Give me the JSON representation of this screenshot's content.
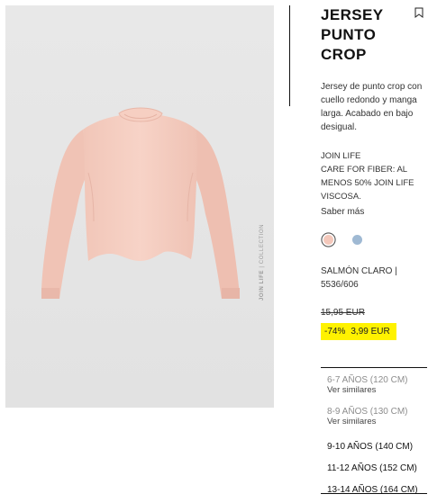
{
  "product": {
    "title_lines": [
      "JERSEY",
      "PUNTO",
      "CROP"
    ],
    "description": "Jersey de punto crop con cuello redondo y manga larga. Acabado en bajo desigual.",
    "join_life_lines": [
      "JOIN LIFE",
      "CARE FOR FIBER: AL",
      "MENOS 50% JOIN LIFE",
      "VISCOSA."
    ],
    "more_link": "Saber más",
    "color_lines": [
      "SALMÓN CLARO |",
      "5536/606"
    ],
    "old_price": "15,95 EUR",
    "discount": "-74%",
    "price": "3,99 EUR",
    "watermark_bold": "JOIN LIFE",
    "watermark_rest": " | COLLECTION"
  },
  "swatches": [
    {
      "name": "salmon",
      "color": "#f4c8bb",
      "selected": true
    },
    {
      "name": "light-blue",
      "color": "#9fb9d3",
      "selected": false
    }
  ],
  "sizes": [
    {
      "label": "6-7 AÑOS (120 CM)",
      "similar": "Ver similares",
      "available": false
    },
    {
      "label": "8-9 AÑOS (130 CM)",
      "similar": "Ver similares",
      "available": false
    },
    {
      "label": "9-10 AÑOS (140 CM)",
      "available": true
    },
    {
      "label": "11-12 AÑOS (152 CM)",
      "available": true
    },
    {
      "label": "13-14 AÑOS (164 CM)",
      "available": true
    }
  ],
  "icons": {
    "bookmark": "bookmark-icon"
  }
}
